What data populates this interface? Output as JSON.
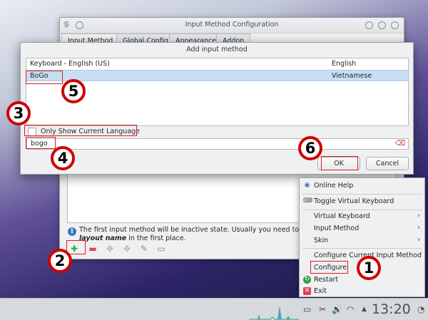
{
  "background_window": {
    "title": "Input Method Configuration",
    "tabs": [
      "Input Method",
      "Global Config",
      "Appearance",
      "Addon"
    ],
    "info_line1": "The first input method will be inactive state. Usually you need to put",
    "info_line2_bold": "layout name",
    "info_line2_rest": " in the first place."
  },
  "dialog": {
    "title": "Add input method",
    "rows": [
      {
        "name": "Keyboard - English (US)",
        "language": "English"
      },
      {
        "name": "BoGo",
        "language": "Vietnamese"
      }
    ],
    "checkbox_label": "Only Show Current Language",
    "search_value": "bogo",
    "ok_label": "OK",
    "cancel_label": "Cancel"
  },
  "menu": {
    "items": [
      {
        "label": "Online Help",
        "icon": "help-icon"
      },
      {
        "label": "Toggle Virtual Keyboard",
        "icon": "keyboard-icon"
      },
      {
        "label": "Virtual Keyboard",
        "submenu": true
      },
      {
        "label": "Input Method",
        "submenu": true
      },
      {
        "label": "Skin",
        "submenu": true
      },
      {
        "label": "Configure Current Input Method"
      },
      {
        "label": "Configure"
      },
      {
        "label": "Restart",
        "icon": "restart-icon"
      },
      {
        "label": "Exit",
        "icon": "exit-icon"
      }
    ]
  },
  "taskbar": {
    "clock": "13:20"
  },
  "annotations": [
    "1",
    "2",
    "3",
    "4",
    "5",
    "6"
  ],
  "colors": {
    "highlight": "#e01b1b",
    "badge_ring": "#d00000",
    "selection": "#c8dff3"
  }
}
